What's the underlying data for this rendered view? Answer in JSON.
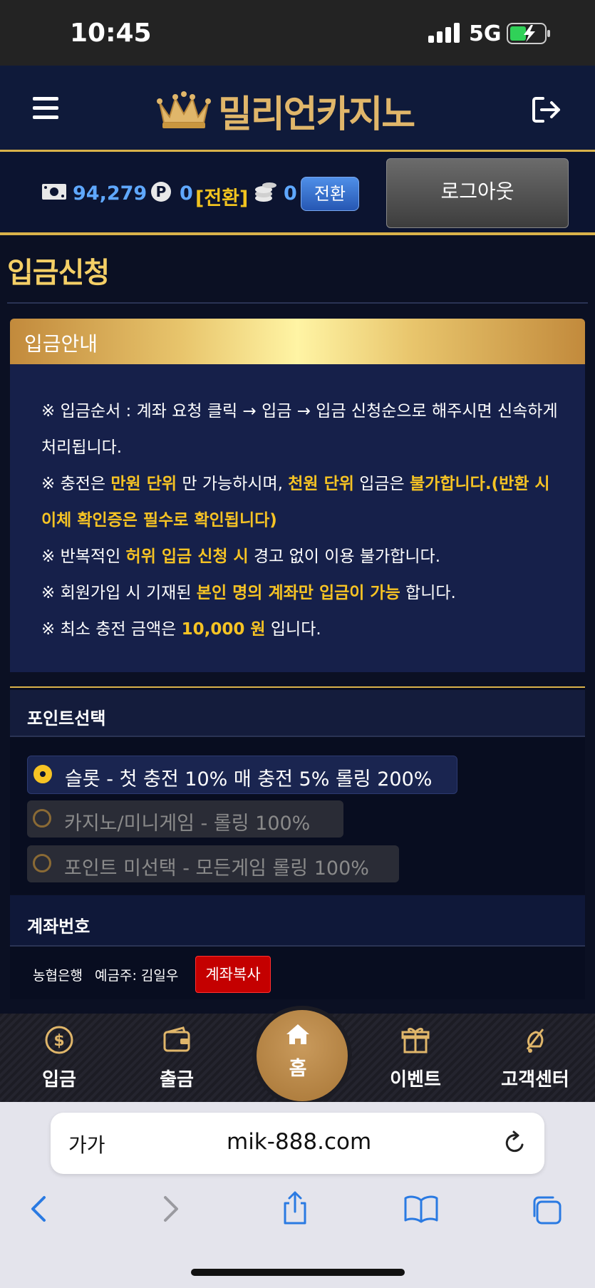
{
  "status_bar": {
    "time": "10:45",
    "network": "5G"
  },
  "header": {
    "logo_text": "밀리언카지노",
    "menu_icon": "hamburger-icon",
    "exit_icon": "logout-arrow-icon"
  },
  "info_bar": {
    "money": "94,279",
    "point_badge": "P",
    "points": "0",
    "point_convert": "[전환]",
    "coins": "0",
    "convert_button": "전환",
    "logout_button": "로그아웃"
  },
  "page": {
    "title": "입금신청"
  },
  "notice": {
    "header": "입금안내",
    "lines": [
      {
        "parts": [
          {
            "t": "※ 입금순서 : 계좌 요청 클릭 → 입금 → 입금 신청순으로 해주시면 신속하게",
            "h": false
          }
        ]
      },
      {
        "parts": [
          {
            "t": "처리됩니다.",
            "h": false
          }
        ]
      },
      {
        "parts": [
          {
            "t": "※ 충전은 ",
            "h": false
          },
          {
            "t": "만원 단위",
            "h": true
          },
          {
            "t": " 만 가능하시며, ",
            "h": false
          },
          {
            "t": "천원 단위",
            "h": true
          },
          {
            "t": " 입금은 ",
            "h": false
          },
          {
            "t": "불가합니다.(반환 시",
            "h": true
          }
        ]
      },
      {
        "parts": [
          {
            "t": "이체 확인증은 필수로 확인됩니다)",
            "h": true
          }
        ]
      },
      {
        "parts": [
          {
            "t": "※ 반복적인 ",
            "h": false
          },
          {
            "t": "허위 입금 신청 시",
            "h": true
          },
          {
            "t": " 경고 없이 이용 불가합니다.",
            "h": false
          }
        ]
      },
      {
        "parts": [
          {
            "t": "※ 회원가입 시 기재된 ",
            "h": false
          },
          {
            "t": "본인 명의 계좌만 입금이 가능",
            "h": true
          },
          {
            "t": " 합니다.",
            "h": false
          }
        ]
      },
      {
        "parts": [
          {
            "t": "※ 최소 충전 금액은 ",
            "h": false
          },
          {
            "t": "10,000 원",
            "h": true
          },
          {
            "t": " 입니다.",
            "h": false
          }
        ]
      }
    ]
  },
  "point_select": {
    "title": "포인트선택",
    "options": [
      {
        "label": "슬롯 - 첫 충전 10% 매 충전 5% 롤링 200%",
        "selected": true
      },
      {
        "label": "카지노/미니게임 - 롤링 100%",
        "selected": false
      },
      {
        "label": "포인트 미선택 - 모든게임 롤링 100%",
        "selected": false
      }
    ]
  },
  "account": {
    "title": "계좌번호",
    "bank": "농협은행",
    "holder": "예금주: 김일우",
    "copy_button": "계좌복사"
  },
  "bottom_nav": {
    "deposit": "입금",
    "withdraw": "출금",
    "home": "홈",
    "event": "이벤트",
    "support": "고객센터"
  },
  "browser": {
    "text_size": "가가",
    "url": "mik-888.com"
  },
  "colors": {
    "gold": "#d9b24a",
    "highlight": "#f6c324",
    "value_blue": "#5fa8ff",
    "copy_red": "#c40000"
  }
}
